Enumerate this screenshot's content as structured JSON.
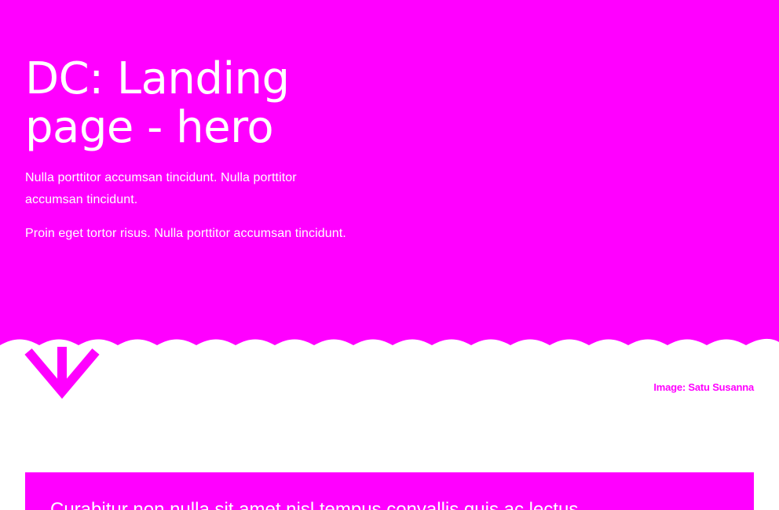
{
  "colors": {
    "accent": "#ff00ff",
    "background": "#ffffff",
    "text_on_accent": "#ffffff"
  },
  "hero": {
    "title": "DC: Landing page - hero",
    "paragraphs": [
      "Nulla porttitor accumsan tincidunt. Nulla porttitor accumsan tincidunt.",
      "Proin eget tortor risus. Nulla porttitor accumsan tincidunt."
    ],
    "scroll_icon": "arrow-down-icon"
  },
  "image_credit": "Image: Satu Susanna",
  "quote": {
    "text": "Curabitur non nulla sit amet nisl tempus convallis quis ac lectus."
  }
}
